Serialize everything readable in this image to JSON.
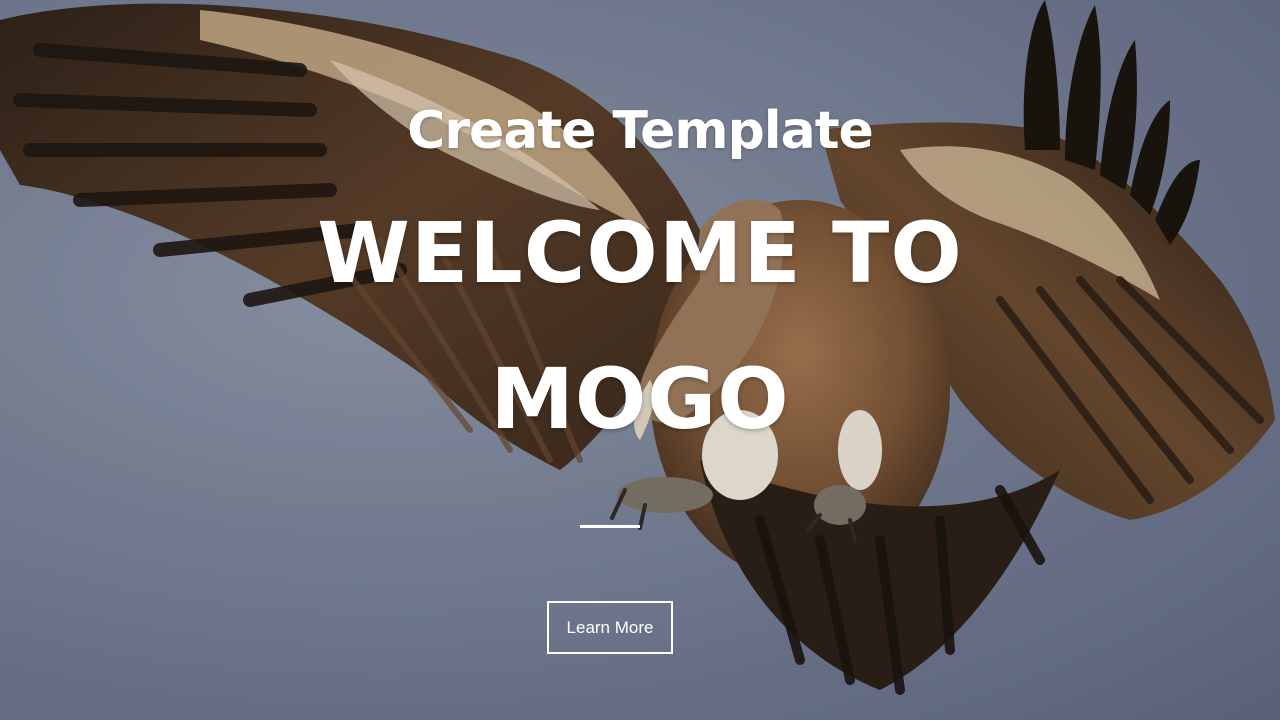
{
  "hero": {
    "subtitle": "Create Template",
    "title_line1": "WELCOME TO",
    "title_line2": "MOGO",
    "button_label": "Learn More"
  },
  "colors": {
    "text": "#ffffff",
    "sky": "#7d869b",
    "feather_dark": "#3a2a1c",
    "feather_mid": "#7a5535",
    "feather_light": "#d8c3a4"
  }
}
